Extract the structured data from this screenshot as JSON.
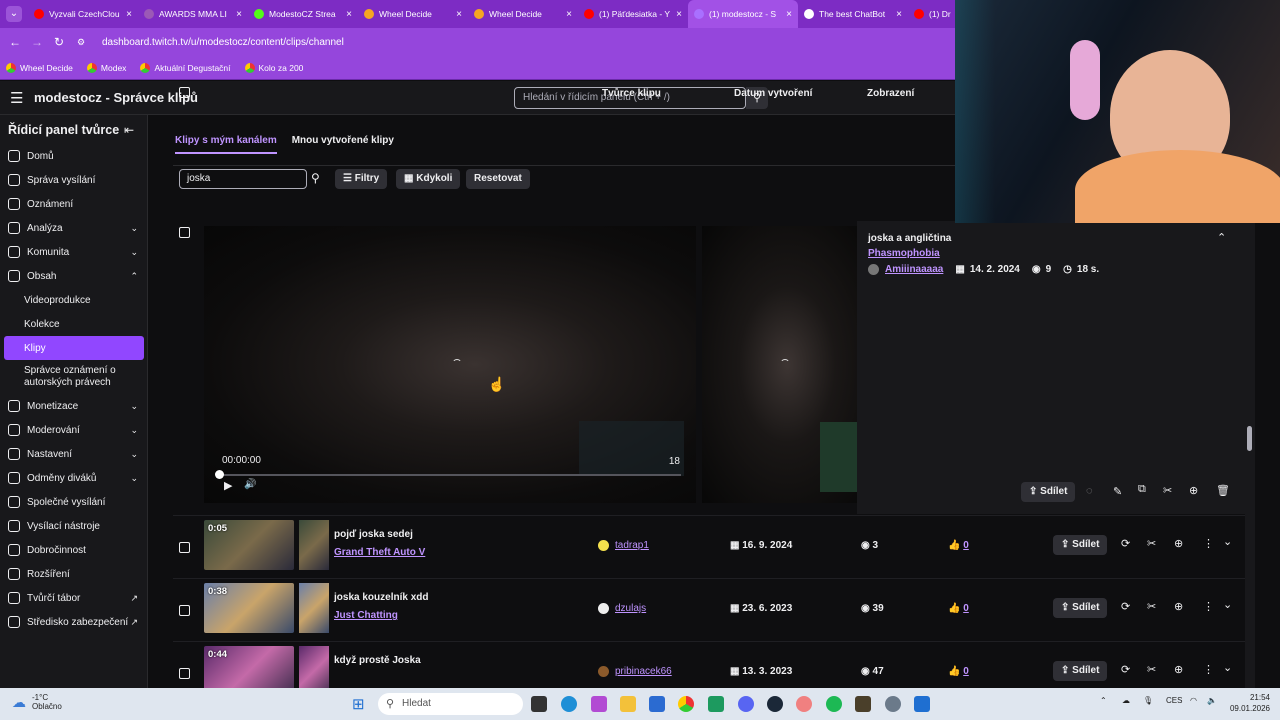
{
  "browser": {
    "tabs": [
      {
        "label": "Vyzvali CzechClou",
        "color": "#ff0000"
      },
      {
        "label": "AWARDS MMA LI",
        "color": "#9b59b6"
      },
      {
        "label": "ModestoCZ Strea",
        "color": "#53fc18"
      },
      {
        "label": "Wheel Decide",
        "color": "#f5a623"
      },
      {
        "label": "Wheel Decide",
        "color": "#f5a623"
      },
      {
        "label": "(1) Päťdesiatka - Y",
        "color": "#ff0000"
      },
      {
        "label": "(1) modestocz - S",
        "color": "#a970ff"
      },
      {
        "label": "The best ChatBot",
        "color": "#ffffff"
      },
      {
        "label": "(1) Dr",
        "color": "#ff0000"
      }
    ],
    "close_glyph": "×",
    "url": "dashboard.twitch.tv/u/modestocz/content/clips/channel",
    "bookmarks": [
      "Wheel Decide",
      "Modex",
      "Aktuální Degustační",
      "Kolo za 200"
    ]
  },
  "header": {
    "title": "modestocz - Správce klipů",
    "search_placeholder": "Hledání v řídicím panelu (Ctrl + /)"
  },
  "sidebar": {
    "title": "Řídicí panel tvůrce",
    "items": [
      {
        "label": "Domů",
        "chev": ""
      },
      {
        "label": "Správa vysílání",
        "chev": ""
      },
      {
        "label": "Oznámení",
        "chev": ""
      },
      {
        "label": "Analýza",
        "chev": "⌄"
      },
      {
        "label": "Komunita",
        "chev": "⌄"
      },
      {
        "label": "Obsah",
        "chev": "⌃"
      }
    ],
    "sub_items": [
      "Videoprodukce",
      "Kolekce",
      "Klipy",
      "Správce oznámení o autorských právech"
    ],
    "items2": [
      {
        "label": "Monetizace",
        "chev": "⌄"
      },
      {
        "label": "Moderování",
        "chev": "⌄"
      },
      {
        "label": "Nastavení",
        "chev": "⌄"
      },
      {
        "label": "Odměny diváků",
        "chev": "⌄"
      },
      {
        "label": "Společné vysílání",
        "chev": ""
      },
      {
        "label": "Vysílací nástroje",
        "chev": ""
      },
      {
        "label": "Dobročinnost",
        "chev": ""
      },
      {
        "label": "Rozšíření",
        "chev": ""
      },
      {
        "label": "Tvůrčí tábor",
        "chev": "↗"
      },
      {
        "label": "Středisko zabezpečení",
        "chev": "↗"
      }
    ]
  },
  "main": {
    "tabs": [
      "Klipy s mým kanálem",
      "Mnou vytvořené klipy"
    ],
    "filter_value": "joska",
    "filters_label": "Filtry",
    "time_label": "Kdykoli",
    "reset_label": "Resetovat",
    "columns": {
      "creator": "Tvůrce klipu",
      "created": "Datum vytvoření",
      "views": "Zobrazení"
    }
  },
  "expanded": {
    "title": "joska a angličtina",
    "game": "Phasmophobia",
    "author": "Amiiinaaaaa",
    "date": "14. 2. 2024",
    "views": "9",
    "duration": "18 s.",
    "player_time": "00:00:00",
    "player_duration": "18",
    "share_label": "Sdílet",
    "progress": 0
  },
  "rows": [
    {
      "duration": "0:05",
      "title": "pojď joska sedej",
      "game": "Grand Theft Auto V",
      "author": "tadrap1",
      "date": "16. 9. 2024",
      "views": "3",
      "likes": "0",
      "share": "Sdílet",
      "avatar_color": "#f4e04d"
    },
    {
      "duration": "0:38",
      "title": "joska kouzelník xdd",
      "game": "Just Chatting",
      "author": "dzulajs",
      "date": "23. 6. 2023",
      "views": "39",
      "likes": "0",
      "share": "Sdílet",
      "avatar_color": "#eeeeee"
    },
    {
      "duration": "0:44",
      "title": "když prostě Joska",
      "game": "",
      "author": "pribinacek66",
      "date": "13. 3. 2023",
      "views": "47",
      "likes": "0",
      "share": "Sdílet",
      "avatar_color": "#8b5a2b"
    }
  ],
  "taskbar": {
    "temperature": "-1°C",
    "weather": "Oblačno",
    "search": "Hledat",
    "lang": "CES",
    "time": "21:54",
    "date": "09.01.2026"
  }
}
